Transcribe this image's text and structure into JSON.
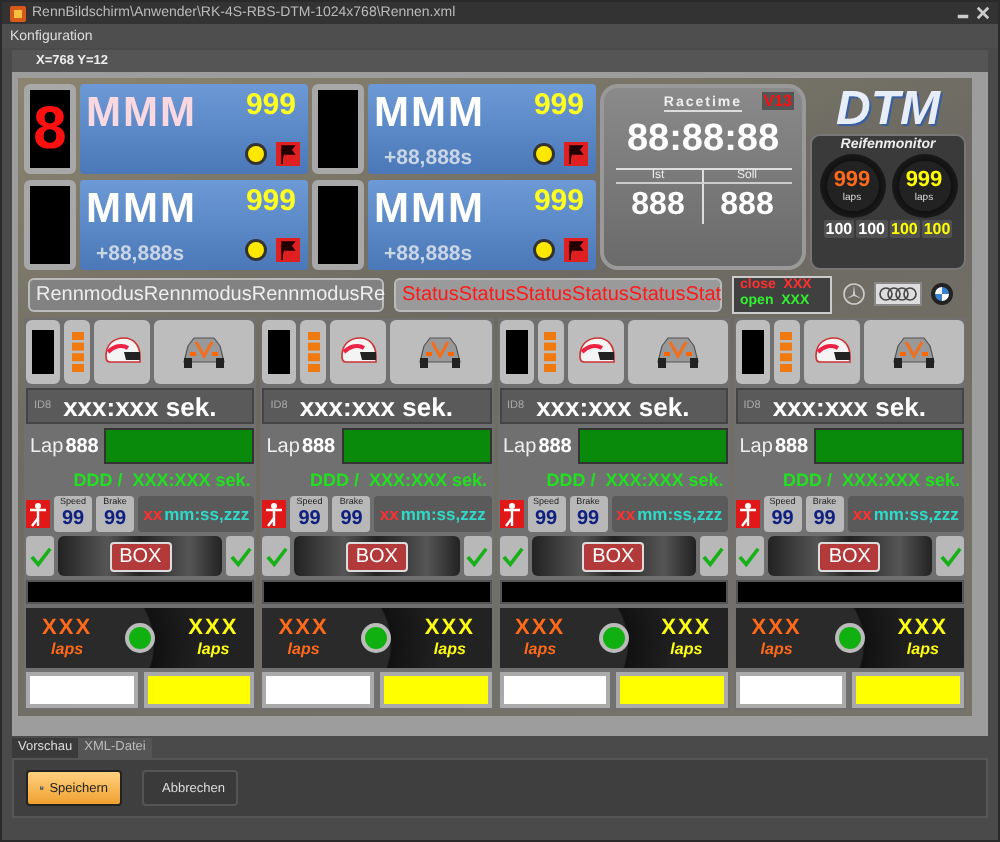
{
  "window": {
    "title": "RennBildschirm\\Anwender\\RK-4S-RBS-DTM-1024x768\\Rennen.xml"
  },
  "menu": [
    "Konfiguration"
  ],
  "coordinates": "X=768 Y=12",
  "positions": [
    {
      "number": "8",
      "name": "MMM",
      "points": "999",
      "highlighted": true
    },
    {
      "name": "MMM",
      "points": "999",
      "gap": "+88,888s",
      "highlighted": false
    },
    {
      "name": "MMM",
      "points": "999",
      "gap": "+88,888s",
      "highlighted": false
    },
    {
      "name": "MMM",
      "points": "999",
      "gap": "+88,888s",
      "highlighted": false
    }
  ],
  "racetime": {
    "title": "Racetime",
    "version": "V13",
    "time": "88:88:88",
    "ist_label": "Ist",
    "soll_label": "Soll",
    "ist": "888",
    "soll": "888"
  },
  "logo": "DTM",
  "tire_monitor": {
    "title": "Reifenmonitor",
    "tires": [
      {
        "value": "999",
        "unit": "laps",
        "color": "#ff6a1a"
      },
      {
        "value": "999",
        "unit": "laps",
        "color": "#ffff00"
      }
    ],
    "readings": [
      {
        "value": "100",
        "color": "#ffffff"
      },
      {
        "value": "100",
        "color": "#ffffff"
      },
      {
        "value": "100",
        "color": "#ffff00"
      },
      {
        "value": "100",
        "color": "#ffff00"
      }
    ]
  },
  "race_mode": "RennmodusRennmodusRennmodusRe",
  "status": "StatusStatusStatusStatusStatusStat",
  "pit_lane": {
    "close": "close  XXX",
    "open": "open  XXX"
  },
  "drivers": [
    {
      "id": "ID8",
      "time": "xxx:xxx sek.",
      "lap_label": "Lap",
      "lap": "888",
      "level": 1,
      "gap": "DDD /  XXX:XXX sek.",
      "speed_label": "Speed",
      "speed": "99",
      "brake_label": "Brake",
      "brake": "99",
      "sector_prefix": "xx",
      "sector": "mm:ss,zzz",
      "box": "BOX",
      "left_check": true,
      "right_check": true,
      "tire_left": {
        "value": "XXX",
        "unit": "laps"
      },
      "tire_right": {
        "value": "XXX",
        "unit": "laps"
      }
    },
    {
      "id": "ID8",
      "time": "xxx:xxx sek.",
      "lap_label": "Lap",
      "lap": "888",
      "level": 1,
      "gap": "DDD /  XXX:XXX sek.",
      "speed_label": "Speed",
      "speed": "99",
      "brake_label": "Brake",
      "brake": "99",
      "sector_prefix": "xx",
      "sector": "mm:ss,zzz",
      "box": "BOX",
      "left_check": true,
      "right_check": true,
      "tire_left": {
        "value": "XXX",
        "unit": "laps"
      },
      "tire_right": {
        "value": "XXX",
        "unit": "laps"
      }
    },
    {
      "id": "ID8",
      "time": "xxx:xxx sek.",
      "lap_label": "Lap",
      "lap": "888",
      "level": 1,
      "gap": "DDD /  XXX:XXX sek.",
      "speed_label": "Speed",
      "speed": "99",
      "brake_label": "Brake",
      "brake": "99",
      "sector_prefix": "xx",
      "sector": "mm:ss,zzz",
      "box": "BOX",
      "left_check": true,
      "right_check": true,
      "tire_left": {
        "value": "XXX",
        "unit": "laps"
      },
      "tire_right": {
        "value": "XXX",
        "unit": "laps"
      }
    },
    {
      "id": "ID8",
      "time": "xxx:xxx sek.",
      "lap_label": "Lap",
      "lap": "888",
      "level": 1,
      "gap": "DDD /  XXX:XXX sek.",
      "speed_label": "Speed",
      "speed": "99",
      "brake_label": "Brake",
      "brake": "99",
      "sector_prefix": "xx",
      "sector": "mm:ss,zzz",
      "box": "BOX",
      "left_check": true,
      "right_check": true,
      "tire_left": {
        "value": "XXX",
        "unit": "laps"
      },
      "tire_right": {
        "value": "XXX",
        "unit": "laps"
      }
    }
  ],
  "tabs": [
    {
      "label": "Vorschau",
      "selected": true
    },
    {
      "label": "XML-Datei",
      "selected": false
    }
  ],
  "buttons": [
    {
      "label": "Speichern",
      "kind": "save"
    },
    {
      "label": "Abbrechen",
      "kind": "cancel"
    }
  ]
}
